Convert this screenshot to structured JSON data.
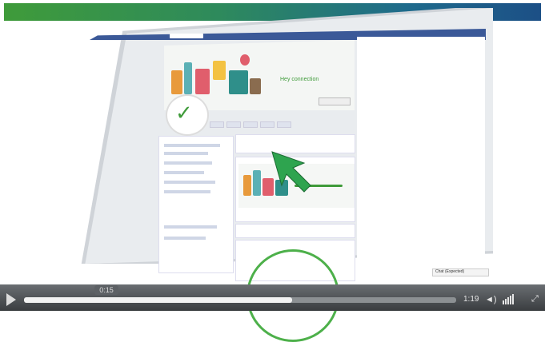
{
  "header": {
    "band_colors": [
      "#3f9b3a",
      "#1c4f86"
    ]
  },
  "video": {
    "tooltip_time": "0:15",
    "remaining_time": "1:19",
    "progress_fraction": 0.62,
    "play_icon": "play-icon",
    "volume_icon": "volume-icon",
    "fullscreen_icon": "fullscreen-icon"
  },
  "screen": {
    "cover_tagline": "Hey connection",
    "chat_label": "Chat (Expected)"
  },
  "colors": {
    "accent": "#3f9b3a",
    "facebook_blue": "#3b5998"
  }
}
